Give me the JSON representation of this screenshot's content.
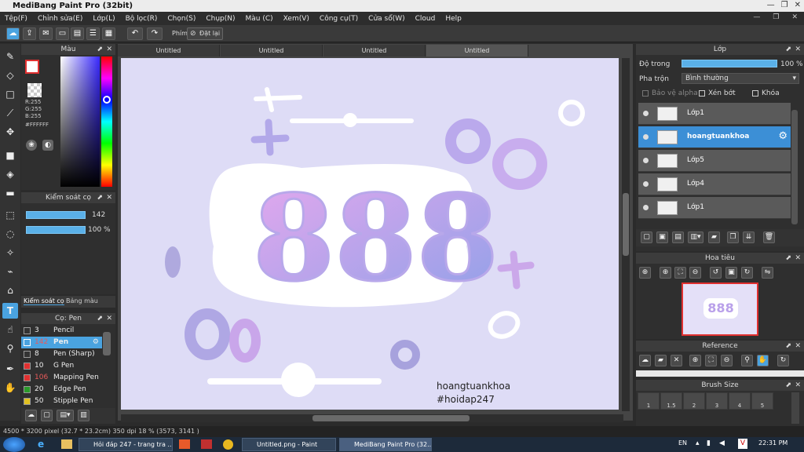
{
  "window": {
    "title": "MediBang Paint Pro (32bit)"
  },
  "menu": [
    "Tệp(F)",
    "Chỉnh sửa(E)",
    "Lớp(L)",
    "Bộ lọc(R)",
    "Chọn(S)",
    "Chụp(N)",
    "Màu (C)",
    "Xem(V)",
    "Công cụ(T)",
    "Cửa sổ(W)",
    "Cloud",
    "Help"
  ],
  "toolbar": {
    "phim_label": "Phím",
    "reset_label": "Đặt lại"
  },
  "color_panel": {
    "title": "Màu",
    "r": "R:255",
    "g": "G:255",
    "b": "B:255",
    "hex": "#FFFFFF",
    "fg_color": "#ffffff",
    "bg_color": "#ffffff"
  },
  "brush_control": {
    "title": "Kiểm soát cọ",
    "size": "142",
    "opacity": "100 %",
    "tab1": "Kiểm soát cọ",
    "tab2": "Bảng màu"
  },
  "brush_panel": {
    "title": "Cọ: Pen",
    "items": [
      {
        "size": "3",
        "name": "Pencil",
        "color": "#333333"
      },
      {
        "size": "142",
        "name": "Pen",
        "color": "#4aa3e0"
      },
      {
        "size": "8",
        "name": "Pen (Sharp)",
        "color": "#333333"
      },
      {
        "size": "10",
        "name": "G Pen",
        "color": "#e03030"
      },
      {
        "size": "106",
        "name": "Mapping Pen",
        "color": "#e03030"
      },
      {
        "size": "20",
        "name": "Edge Pen",
        "color": "#2a9a2a"
      },
      {
        "size": "50",
        "name": "Stipple Pen",
        "color": "#e0c020"
      }
    ]
  },
  "tabs": [
    "Untitled",
    "Untitled",
    "Untitled",
    "Untitled"
  ],
  "canvas": {
    "sign_name": "hoangtuankhoa",
    "sign_tag": "#hoidap247",
    "big_text": "888"
  },
  "layers_panel": {
    "title": "Lớp",
    "opacity_label": "Độ trong",
    "opacity_value": "100 %",
    "blend_label": "Pha trộn",
    "blend_value": "Bình thường",
    "protect_alpha": "Bảo vệ alpha",
    "clipping": "Xén bớt",
    "lock": "Khóa",
    "items": [
      "Lớp1",
      "hoangtuankhoa",
      "Lớp5",
      "Lớp4",
      "Lớp1"
    ]
  },
  "navigator": {
    "title": "Hoa tiêu"
  },
  "reference": {
    "title": "Reference"
  },
  "brush_size": {
    "title": "Brush Size",
    "values": [
      "1",
      "1.5",
      "2",
      "3",
      "4",
      "5"
    ]
  },
  "status": {
    "text": "4500 * 3200 pixel   (32.7 * 23.2cm)  350 dpi   18 %   (3573, 3141 )"
  },
  "taskbar": {
    "items": [
      "Hỏi đáp 247 - trang tra ...",
      "Untitled.png - Paint",
      "MediBang Paint Pro (32..."
    ],
    "lang": "EN",
    "time": "22:31 PM"
  }
}
